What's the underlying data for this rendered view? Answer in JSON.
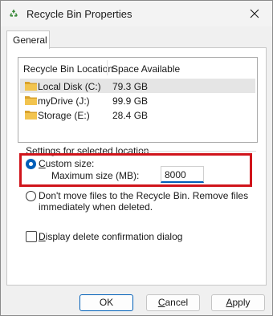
{
  "window": {
    "title": "Recycle Bin Properties",
    "icon": "recycle-bin-icon",
    "close_icon": "close-icon"
  },
  "tabs": [
    {
      "label": "General"
    }
  ],
  "list": {
    "headers": [
      "Recycle Bin Location",
      "Space Available"
    ],
    "rows": [
      {
        "name": "Local Disk (C:)",
        "space": "79.3 GB",
        "selected": true
      },
      {
        "name": "myDrive (J:)",
        "space": "99.9 GB",
        "selected": false
      },
      {
        "name": "Storage (E:)",
        "space": "28.4 GB",
        "selected": false
      }
    ],
    "row_icon": "folder-icon"
  },
  "settings": {
    "group_label": "Settings for selected location",
    "custom_size_label": "Custom size:",
    "custom_size_selected": true,
    "max_size_label": "Maximum size (MB):",
    "max_size_value": "8000",
    "dont_move_label_line1": "Don't move files to the Recycle Bin. Remove files",
    "dont_move_label_line2": "immediately when deleted.",
    "dont_move_selected": false,
    "confirm_label": "Display delete confirmation dialog",
    "confirm_checked": false
  },
  "buttons": {
    "ok": "OK",
    "cancel": "Cancel",
    "apply": "Apply"
  },
  "colors": {
    "accent": "#005fb8",
    "highlight": "#d0141b",
    "folder": "#e8b33a"
  }
}
